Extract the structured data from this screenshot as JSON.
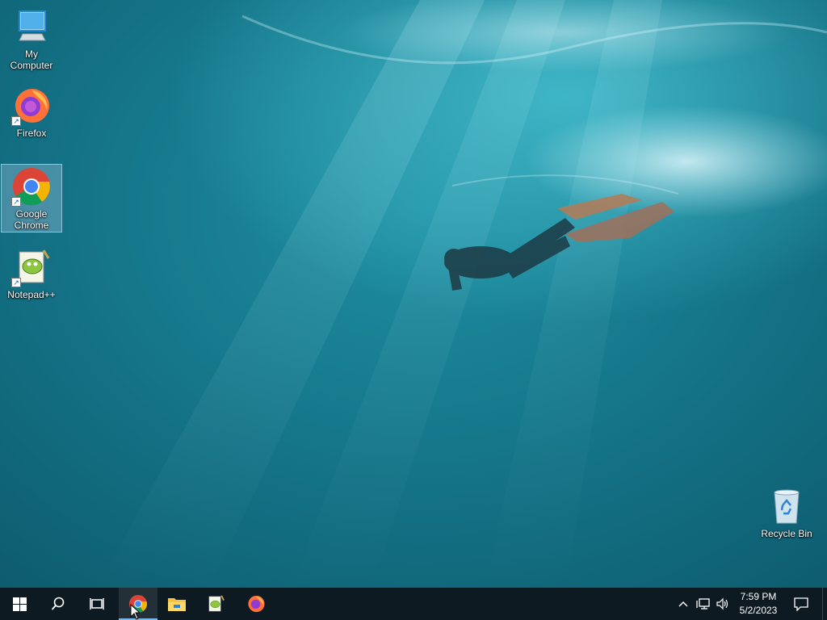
{
  "desktop": {
    "icons": [
      {
        "label": "My Computer",
        "icon": "computer-icon"
      },
      {
        "label": "Firefox",
        "icon": "firefox-icon"
      },
      {
        "label": "Google Chrome",
        "icon": "chrome-icon"
      },
      {
        "label": "Notepad++",
        "icon": "notepadpp-icon"
      },
      {
        "label": "Recycle Bin",
        "icon": "recycle-bin-icon"
      }
    ]
  },
  "taskbar": {
    "pinned": [
      "start-icon",
      "search-icon",
      "task-view-icon",
      "chrome-icon",
      "file-explorer-icon",
      "notepadpp-icon",
      "firefox-icon"
    ],
    "active_app": "chrome",
    "clock": {
      "time": "7:59 PM",
      "date": "5/2/2023"
    }
  },
  "colors": {
    "taskbar": "#0d1a22",
    "active_underline": "#78b7e8",
    "water": "#136f83"
  }
}
